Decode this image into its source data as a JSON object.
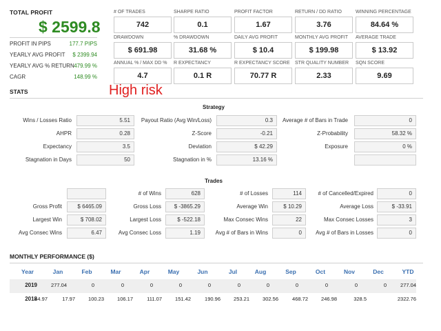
{
  "summary": {
    "total_profit_label": "TOTAL PROFIT",
    "total_profit_value": "$ 2599.8",
    "rows": [
      {
        "label": "PROFIT IN PIPS",
        "value": "177.7 PIPS"
      },
      {
        "label": "YEARLY AVG PROFIT",
        "value": "$ 2399.94"
      },
      {
        "label": "YEARLY AVG % RETURN",
        "value": "479.99 %"
      },
      {
        "label": "CAGR",
        "value": "148.99 %"
      }
    ]
  },
  "metrics": [
    {
      "label": "# OF TRADES",
      "value": "742"
    },
    {
      "label": "SHARPE RATIO",
      "value": "0.1"
    },
    {
      "label": "PROFIT FACTOR",
      "value": "1.67"
    },
    {
      "label": "RETURN / DD RATIO",
      "value": "3.76"
    },
    {
      "label": "WINNING PERCENTAGE",
      "value": "84.64 %"
    },
    {
      "label": "DRAWDOWN",
      "value": "$ 691.98"
    },
    {
      "label": "% DRAWDOWN",
      "value": "31.68 %"
    },
    {
      "label": "DAILY AVG PROFIT",
      "value": "$ 10.4"
    },
    {
      "label": "MONTHLY AVG PROFIT",
      "value": "$ 199.98"
    },
    {
      "label": "AVERAGE TRADE",
      "value": "$ 13.92"
    },
    {
      "label": "ANNUAL % / MAX DD %",
      "value": "4.7"
    },
    {
      "label": "R EXPECTANCY",
      "value": "0.1 R"
    },
    {
      "label": "R EXPECTANCY SCORE",
      "value": "70.77 R"
    },
    {
      "label": "STR QUALITY NUMBER",
      "value": "2.33"
    },
    {
      "label": "SQN SCORE",
      "value": "9.69"
    }
  ],
  "annotation": "High risk",
  "stats_title": "STATS",
  "strategy": {
    "title": "Strategy",
    "rows": [
      [
        {
          "label": "Wins / Losses Ratio",
          "value": "5.51"
        },
        {
          "label": "Payout Ratio (Avg Win/Loss)",
          "value": "0.3"
        },
        {
          "label": "Average # of Bars in Trade",
          "value": "0"
        }
      ],
      [
        {
          "label": "AHPR",
          "value": "0.28"
        },
        {
          "label": "Z-Score",
          "value": "-0.21"
        },
        {
          "label": "Z-Probability",
          "value": "58.32 %"
        }
      ],
      [
        {
          "label": "Expectancy",
          "value": "3.5"
        },
        {
          "label": "Deviation",
          "value": "$ 42.29"
        },
        {
          "label": "Exposure",
          "value": "0 %"
        }
      ],
      [
        {
          "label": "Stagnation in Days",
          "value": "50"
        },
        {
          "label": "Stagnation in %",
          "value": "13.16 %"
        },
        {
          "label": "",
          "value": ""
        }
      ]
    ]
  },
  "trades": {
    "title": "Trades",
    "rows": [
      [
        {
          "label": "",
          "value": ""
        },
        {
          "label": "# of Wins",
          "value": "628"
        },
        {
          "label": "# of Losses",
          "value": "114"
        },
        {
          "label": "# of Cancelled/Expired",
          "value": "0"
        }
      ],
      [
        {
          "label": "Gross Profit",
          "value": "$ 6465.09"
        },
        {
          "label": "Gross Loss",
          "value": "$ -3865.29"
        },
        {
          "label": "Average Win",
          "value": "$ 10.29"
        },
        {
          "label": "Average Loss",
          "value": "$ -33.91"
        }
      ],
      [
        {
          "label": "Largest Win",
          "value": "$ 708.02"
        },
        {
          "label": "Largest Loss",
          "value": "$ -522.18"
        },
        {
          "label": "Max Consec Wins",
          "value": "22"
        },
        {
          "label": "Max Consec Losses",
          "value": "3"
        }
      ],
      [
        {
          "label": "Avg Consec Wins",
          "value": "6.47"
        },
        {
          "label": "Avg Consec Loss",
          "value": "1.19"
        },
        {
          "label": "Avg # of Bars in Wins",
          "value": "0"
        },
        {
          "label": "Avg # of Bars in Losses",
          "value": "0"
        }
      ]
    ]
  },
  "monthly": {
    "title": "MONTHLY PERFORMANCE ($)",
    "headers": [
      "Year",
      "Jan",
      "Feb",
      "Mar",
      "Apr",
      "May",
      "Jun",
      "Jul",
      "Aug",
      "Sep",
      "Oct",
      "Nov",
      "Dec",
      "YTD"
    ],
    "rows": [
      {
        "year": "2019",
        "values": [
          "277.04",
          "0",
          "0",
          "0",
          "0",
          "0",
          "0",
          "0",
          "0",
          "0",
          "0",
          "0",
          "277.04"
        ]
      },
      {
        "year": "2018",
        "values": [
          "44.97",
          "17.97",
          "100.23",
          "106.17",
          "111.07",
          "151.42",
          "190.96",
          "253.21",
          "302.56",
          "468.72",
          "246.98",
          "328.5",
          "2322.76"
        ]
      }
    ]
  },
  "colors": {
    "profit_green": "#2e8b22",
    "risk_red": "#e02020",
    "header_blue": "#3a6fb0"
  }
}
